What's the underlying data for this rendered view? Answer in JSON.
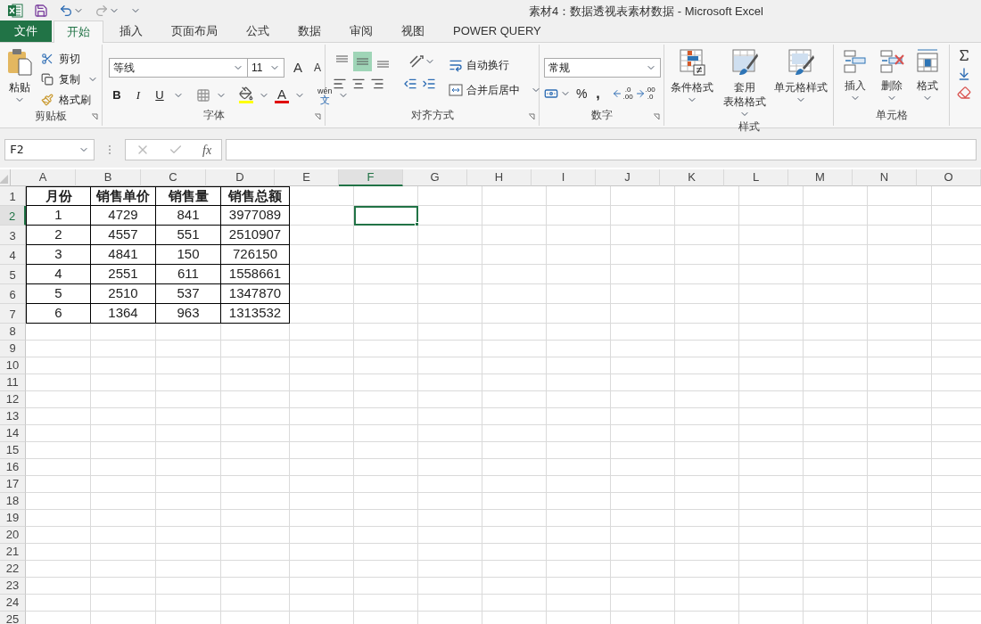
{
  "title": "素材4：数据透视表素材数据 - Microsoft Excel",
  "tabs": [
    {
      "label": "文件",
      "kind": "file",
      "selected": false
    },
    {
      "label": "开始",
      "kind": "tab",
      "selected": true
    },
    {
      "label": "插入",
      "kind": "tab",
      "selected": false
    },
    {
      "label": "页面布局",
      "kind": "tab",
      "selected": false
    },
    {
      "label": "公式",
      "kind": "tab",
      "selected": false
    },
    {
      "label": "数据",
      "kind": "tab",
      "selected": false
    },
    {
      "label": "审阅",
      "kind": "tab",
      "selected": false
    },
    {
      "label": "视图",
      "kind": "tab",
      "selected": false
    },
    {
      "label": "POWER QUERY",
      "kind": "tab",
      "selected": false
    }
  ],
  "clipboard": {
    "label": "剪贴板",
    "paste": "粘贴",
    "cut": "剪切",
    "copy": "复制",
    "format_painter": "格式刷"
  },
  "font": {
    "label": "字体",
    "font_name": "等线",
    "font_size": "11",
    "grow": "A",
    "shrink": "A",
    "bold": "B",
    "italic": "I",
    "underline": "U",
    "font_color": "A",
    "phonetic_top": "wén",
    "phonetic_bottom": "文"
  },
  "alignment": {
    "label": "对齐方式",
    "vertical_align": [
      {
        "selected": false
      },
      {
        "selected": true
      },
      {
        "selected": false
      }
    ],
    "wrap_text": "自动换行",
    "merge_center": "合并后居中"
  },
  "number": {
    "label": "数字",
    "format": "常规",
    "percent": "%",
    "comma": ",",
    "decimal_increase": {
      "top": ".0",
      "bottom": ".00"
    },
    "decimal_decrease": {
      "top": ".00",
      "bottom": ".0"
    }
  },
  "styles": {
    "label": "样式",
    "conditional": "条件格式",
    "table_top": "套用",
    "table_bottom": "表格格式",
    "cell_styles": "单元格样式"
  },
  "cells": {
    "label": "单元格",
    "insert": "插入",
    "delete": "删除",
    "format": "格式"
  },
  "name_box": "F2",
  "function_label": "fx",
  "sheet": {
    "columns": [
      {
        "label": "A",
        "selected": false
      },
      {
        "label": "B",
        "selected": false
      },
      {
        "label": "C",
        "selected": false
      },
      {
        "label": "D",
        "selected": false
      },
      {
        "label": "E",
        "selected": false
      },
      {
        "label": "F",
        "selected": true
      },
      {
        "label": "G",
        "selected": false
      },
      {
        "label": "H",
        "selected": false
      },
      {
        "label": "I",
        "selected": false
      },
      {
        "label": "J",
        "selected": false
      },
      {
        "label": "K",
        "selected": false
      },
      {
        "label": "L",
        "selected": false
      },
      {
        "label": "M",
        "selected": false
      },
      {
        "label": "N",
        "selected": false
      },
      {
        "label": "O",
        "selected": false
      }
    ],
    "rows": [
      {
        "number": "1",
        "selected": false,
        "kind": "header",
        "cells": [
          "月份",
          "销售单价",
          "销售量",
          "销售总额"
        ]
      },
      {
        "number": "2",
        "selected": true,
        "kind": "data",
        "cells": [
          "1",
          "4729",
          "841",
          "3977089"
        ]
      },
      {
        "number": "3",
        "selected": false,
        "kind": "data",
        "cells": [
          "2",
          "4557",
          "551",
          "2510907"
        ]
      },
      {
        "number": "4",
        "selected": false,
        "kind": "data",
        "cells": [
          "3",
          "4841",
          "150",
          "726150"
        ]
      },
      {
        "number": "5",
        "selected": false,
        "kind": "data",
        "cells": [
          "4",
          "2551",
          "611",
          "1558661"
        ]
      },
      {
        "number": "6",
        "selected": false,
        "kind": "data",
        "cells": [
          "5",
          "2510",
          "537",
          "1347870"
        ]
      },
      {
        "number": "7",
        "selected": false,
        "kind": "data",
        "cells": [
          "6",
          "1364",
          "963",
          "1313532"
        ]
      },
      {
        "number": "8",
        "selected": false
      },
      {
        "number": "9",
        "selected": false
      },
      {
        "number": "10",
        "selected": false
      },
      {
        "number": "11",
        "selected": false
      },
      {
        "number": "12",
        "selected": false
      },
      {
        "number": "13",
        "selected": false
      },
      {
        "number": "14",
        "selected": false
      },
      {
        "number": "15",
        "selected": false
      },
      {
        "number": "16",
        "selected": false
      },
      {
        "number": "17",
        "selected": false
      },
      {
        "number": "18",
        "selected": false
      },
      {
        "number": "19",
        "selected": false
      },
      {
        "number": "20",
        "selected": false
      },
      {
        "number": "21",
        "selected": false
      },
      {
        "number": "22",
        "selected": false
      },
      {
        "number": "23",
        "selected": false
      },
      {
        "number": "24",
        "selected": false
      },
      {
        "number": "25",
        "selected": false
      }
    ]
  }
}
